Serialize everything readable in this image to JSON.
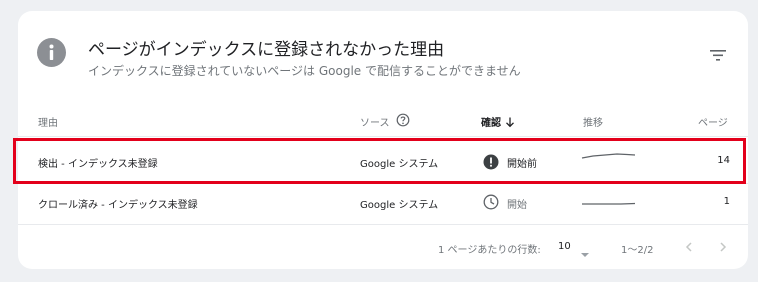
{
  "header": {
    "title": "ページがインデックスに登録されなかった理由",
    "subtitle": "インデックスに登録されていないページは Google で配信することができません"
  },
  "table": {
    "columns": {
      "reason": "理由",
      "source": "ソース",
      "validation": "確認",
      "trend": "推移",
      "pages": "ページ"
    },
    "rows": [
      {
        "reason": "検出 - インデックス未登録",
        "source": "Google システム",
        "validation": "開始前",
        "validation_icon": "error-icon",
        "pages": "14",
        "highlighted": true
      },
      {
        "reason": "クロール済み - インデックス未登録",
        "source": "Google システム",
        "validation": "開始",
        "validation_icon": "clock-icon",
        "pages": "1",
        "highlighted": false
      }
    ]
  },
  "footer": {
    "rows_per_page_label": "1 ページあたりの行数:",
    "rows_per_page_value": "10",
    "range": "1〜2/2"
  },
  "colors": {
    "highlight_border": "#e3001b",
    "info_icon": "#8c8f94",
    "error_icon": "#3c4043"
  }
}
